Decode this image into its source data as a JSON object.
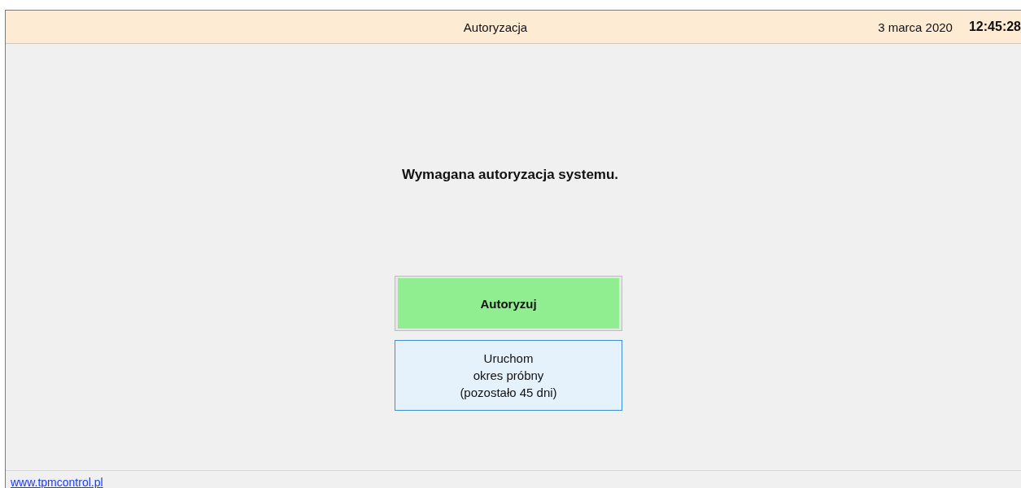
{
  "header": {
    "title": "Autoryzacja",
    "date": "3 marca 2020",
    "time": "12:45:28"
  },
  "message": "Wymagana autoryzacja systemu.",
  "buttons": [
    {
      "kind": "primary",
      "lines": [
        "Autoryzuj"
      ]
    },
    {
      "kind": "secondary",
      "lines": [
        "Uruchom",
        "okres próbny",
        "(pozostało 45 dni)"
      ]
    }
  ],
  "footer": {
    "link": "www.tpmcontrol.pl"
  }
}
